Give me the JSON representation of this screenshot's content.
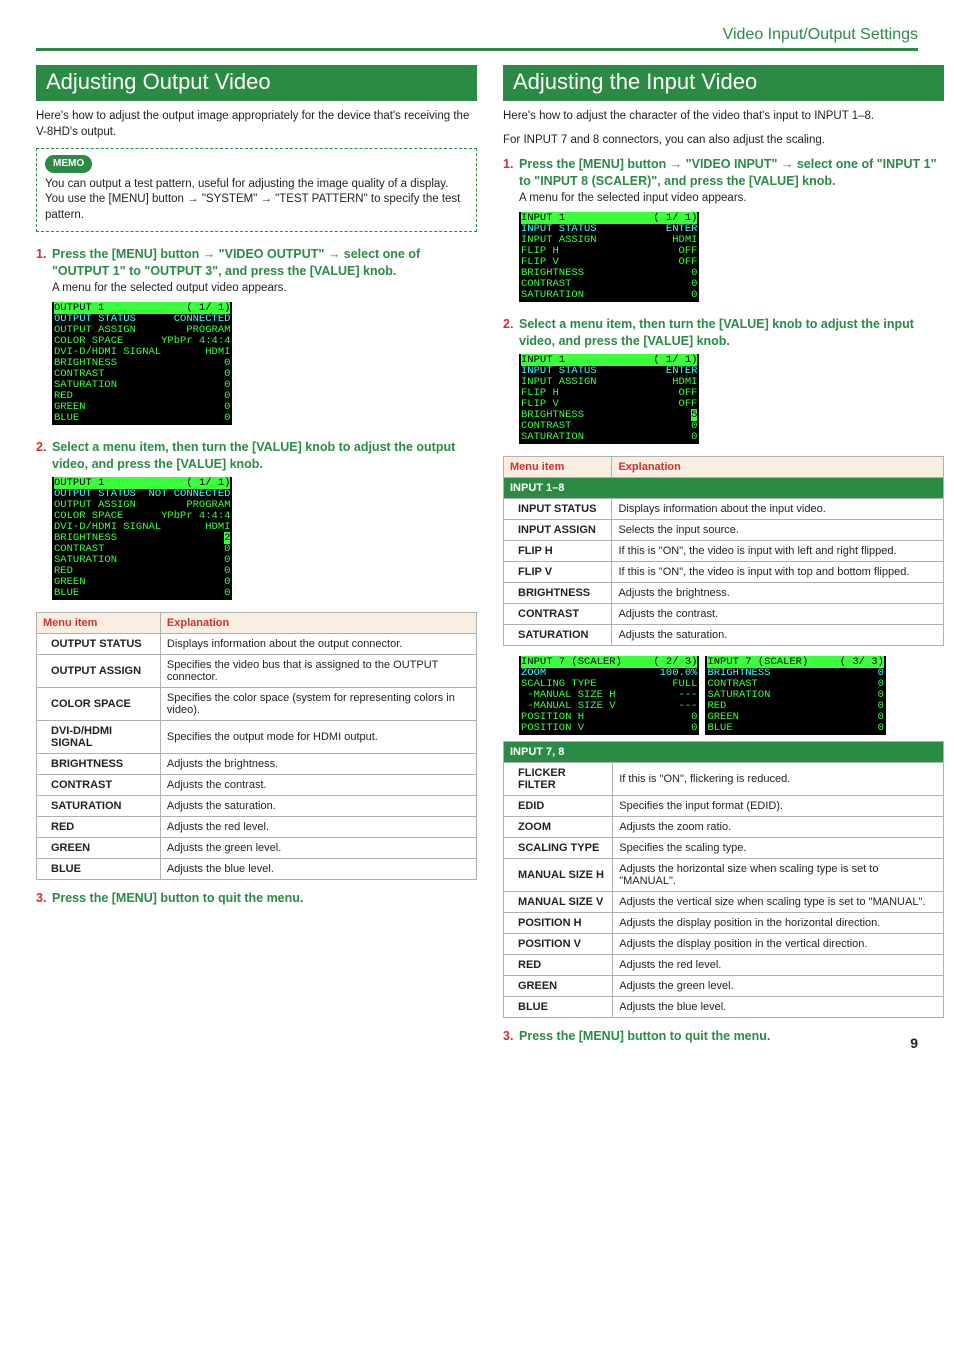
{
  "header": {
    "section": "Video Input/Output Settings"
  },
  "page_number": "9",
  "left": {
    "title": "Adjusting Output Video",
    "intro": "Here's how to adjust the output image appropriately for the device that's receiving the V-8HD's output.",
    "memo": {
      "label": "MEMO",
      "p1": "You can output a test pattern, useful for adjusting the image quality of a display.",
      "p2_a": "You use the [MENU] button ",
      "p2_b": " \"SYSTEM\" ",
      "p2_c": " \"TEST PATTERN\" to specify the test pattern."
    },
    "step1": {
      "num": "1.",
      "t1": "Press the [MENU] button ",
      "t2": " \"VIDEO OUTPUT\" ",
      "t3": " select one of \"OUTPUT 1\" to \"OUTPUT 3\", and press the [VALUE] knob.",
      "sub": "A menu for the selected output video appears."
    },
    "osd1": [
      {
        "l": "OUTPUT 1",
        "r": "( 1/ 1)",
        "hl": true
      },
      {
        "l": "OUTPUT STATUS",
        "r": "CONNECTED",
        "cy": true
      },
      {
        "l": "OUTPUT ASSIGN",
        "r": "PROGRAM"
      },
      {
        "l": "COLOR SPACE",
        "r": "YPbPr 4:4:4"
      },
      {
        "l": "DVI-D/HDMI SIGNAL",
        "r": "HDMI"
      },
      {
        "l": "BRIGHTNESS",
        "r": "0"
      },
      {
        "l": "CONTRAST",
        "r": "0"
      },
      {
        "l": "SATURATION",
        "r": "0"
      },
      {
        "l": "RED",
        "r": "0"
      },
      {
        "l": "GREEN",
        "r": "0"
      },
      {
        "l": "BLUE",
        "r": "0"
      }
    ],
    "step2": {
      "num": "2.",
      "text": "Select a menu item, then turn the [VALUE] knob to adjust the output video, and press the [VALUE] knob."
    },
    "osd2": [
      {
        "l": "OUTPUT 1",
        "r": "( 1/ 1)",
        "hl": true
      },
      {
        "l": "OUTPUT STATUS",
        "r": "NOT CONNECTED",
        "cy": true
      },
      {
        "l": "OUTPUT ASSIGN",
        "r": "PROGRAM"
      },
      {
        "l": "COLOR SPACE",
        "r": "YPbPr 4:4:4"
      },
      {
        "l": "DVI-D/HDMI SIGNAL",
        "r": "HDMI"
      },
      {
        "l": "BRIGHTNESS",
        "r": "2",
        "hl_r": true
      },
      {
        "l": "CONTRAST",
        "r": "0"
      },
      {
        "l": "SATURATION",
        "r": "0"
      },
      {
        "l": "RED",
        "r": "0"
      },
      {
        "l": "GREEN",
        "r": "0"
      },
      {
        "l": "BLUE",
        "r": "0"
      }
    ],
    "table": {
      "h1": "Menu item",
      "h2": "Explanation",
      "rows": [
        {
          "k": "OUTPUT STATUS",
          "v": "Displays information about the output connector."
        },
        {
          "k": "OUTPUT ASSIGN",
          "v": "Specifies the video bus that is assigned to the OUTPUT connector."
        },
        {
          "k": "COLOR SPACE",
          "v": "Specifies the color space (system for representing colors in video)."
        },
        {
          "k": "DVI-D/HDMI SIGNAL",
          "v": "Specifies the output mode for HDMI output."
        },
        {
          "k": "BRIGHTNESS",
          "v": "Adjusts the brightness."
        },
        {
          "k": "CONTRAST",
          "v": "Adjusts the contrast."
        },
        {
          "k": "SATURATION",
          "v": "Adjusts the saturation."
        },
        {
          "k": "RED",
          "v": "Adjusts the red level."
        },
        {
          "k": "GREEN",
          "v": "Adjusts the green level."
        },
        {
          "k": "BLUE",
          "v": "Adjusts the blue level."
        }
      ]
    },
    "step3": {
      "num": "3.",
      "text": "Press the [MENU] button to quit the menu."
    }
  },
  "right": {
    "title": "Adjusting the Input Video",
    "intro1": "Here's how to adjust the character of the video that's input to INPUT 1–8.",
    "intro2": "For INPUT 7 and 8 connectors, you can also adjust the scaling.",
    "step1": {
      "num": "1.",
      "t1": "Press the [MENU] button ",
      "t2": " \"VIDEO INPUT\" ",
      "t3": " select one of \"INPUT 1\" to \"INPUT 8 (SCALER)\", and press the [VALUE] knob.",
      "sub": "A menu for the selected input video appears."
    },
    "osd1": [
      {
        "l": "INPUT 1",
        "r": "( 1/ 1)",
        "hl": true
      },
      {
        "l": "INPUT STATUS",
        "r": "ENTER",
        "cy": true
      },
      {
        "l": "INPUT ASSIGN",
        "r": "HDMI"
      },
      {
        "l": "FLIP H",
        "r": "OFF"
      },
      {
        "l": "FLIP V",
        "r": "OFF"
      },
      {
        "l": "BRIGHTNESS",
        "r": "0"
      },
      {
        "l": "CONTRAST",
        "r": "0"
      },
      {
        "l": "SATURATION",
        "r": "0"
      }
    ],
    "step2": {
      "num": "2.",
      "text": "Select a menu item, then turn the [VALUE] knob to adjust the input video, and press the [VALUE] knob."
    },
    "osd2": [
      {
        "l": "INPUT 1",
        "r": "( 1/ 1)",
        "hl": true
      },
      {
        "l": "INPUT STATUS",
        "r": "ENTER",
        "cy": true
      },
      {
        "l": "INPUT ASSIGN",
        "r": "HDMI"
      },
      {
        "l": "FLIP H",
        "r": "OFF"
      },
      {
        "l": "FLIP V",
        "r": "OFF"
      },
      {
        "l": "BRIGHTNESS",
        "r": "5",
        "hl_r": true
      },
      {
        "l": "CONTRAST",
        "r": "0"
      },
      {
        "l": "SATURATION",
        "r": "0"
      }
    ],
    "table1": {
      "h1": "Menu item",
      "h2": "Explanation",
      "group": "INPUT 1–8",
      "rows": [
        {
          "k": "INPUT STATUS",
          "v": "Displays information about the input video."
        },
        {
          "k": "INPUT ASSIGN",
          "v": "Selects the input source."
        },
        {
          "k": "FLIP H",
          "v": "If this is \"ON\", the video is input with left and right flipped."
        },
        {
          "k": "FLIP V",
          "v": "If this is \"ON\", the video is input with top and bottom flipped."
        },
        {
          "k": "BRIGHTNESS",
          "v": "Adjusts the brightness."
        },
        {
          "k": "CONTRAST",
          "v": "Adjusts the contrast."
        },
        {
          "k": "SATURATION",
          "v": "Adjusts the saturation."
        }
      ]
    },
    "osd3a": [
      {
        "l": "INPUT 7 (SCALER)",
        "r": "( 2/ 3)",
        "hl": true
      },
      {
        "l": "ZOOM",
        "r": "100.0%",
        "cy": true
      },
      {
        "l": "SCALING TYPE",
        "r": "FULL"
      },
      {
        "l": " -MANUAL SIZE H",
        "r": "---"
      },
      {
        "l": " -MANUAL SIZE V",
        "r": "---"
      },
      {
        "l": "POSITION H",
        "r": "0"
      },
      {
        "l": "POSITION V",
        "r": "0"
      }
    ],
    "osd3b": [
      {
        "l": "INPUT 7 (SCALER)",
        "r": "( 3/ 3)",
        "hl": true
      },
      {
        "l": "BRIGHTNESS",
        "r": "0",
        "cy": true
      },
      {
        "l": "CONTRAST",
        "r": "0"
      },
      {
        "l": "SATURATION",
        "r": "0"
      },
      {
        "l": "RED",
        "r": "0"
      },
      {
        "l": "GREEN",
        "r": "0"
      },
      {
        "l": "BLUE",
        "r": "0"
      }
    ],
    "table2": {
      "group": "INPUT 7, 8",
      "rows": [
        {
          "k": "FLICKER FILTER",
          "v": "If this is \"ON\", flickering is reduced."
        },
        {
          "k": "EDID",
          "v": "Specifies the input format (EDID)."
        },
        {
          "k": "ZOOM",
          "v": "Adjusts the zoom ratio."
        },
        {
          "k": "SCALING TYPE",
          "v": "Specifies the scaling type."
        },
        {
          "k": "MANUAL SIZE H",
          "v": "Adjusts the horizontal size when scaling type is set to \"MANUAL\"."
        },
        {
          "k": "MANUAL SIZE V",
          "v": "Adjusts the vertical size when scaling type is set to \"MANUAL\"."
        },
        {
          "k": "POSITION H",
          "v": "Adjusts the display position in the horizontal direction."
        },
        {
          "k": "POSITION V",
          "v": "Adjusts the display position in the vertical direction."
        },
        {
          "k": "RED",
          "v": "Adjusts the red level."
        },
        {
          "k": "GREEN",
          "v": "Adjusts the green level."
        },
        {
          "k": "BLUE",
          "v": "Adjusts the blue level."
        }
      ]
    },
    "step3": {
      "num": "3.",
      "text": "Press the [MENU] button to quit the menu."
    }
  }
}
